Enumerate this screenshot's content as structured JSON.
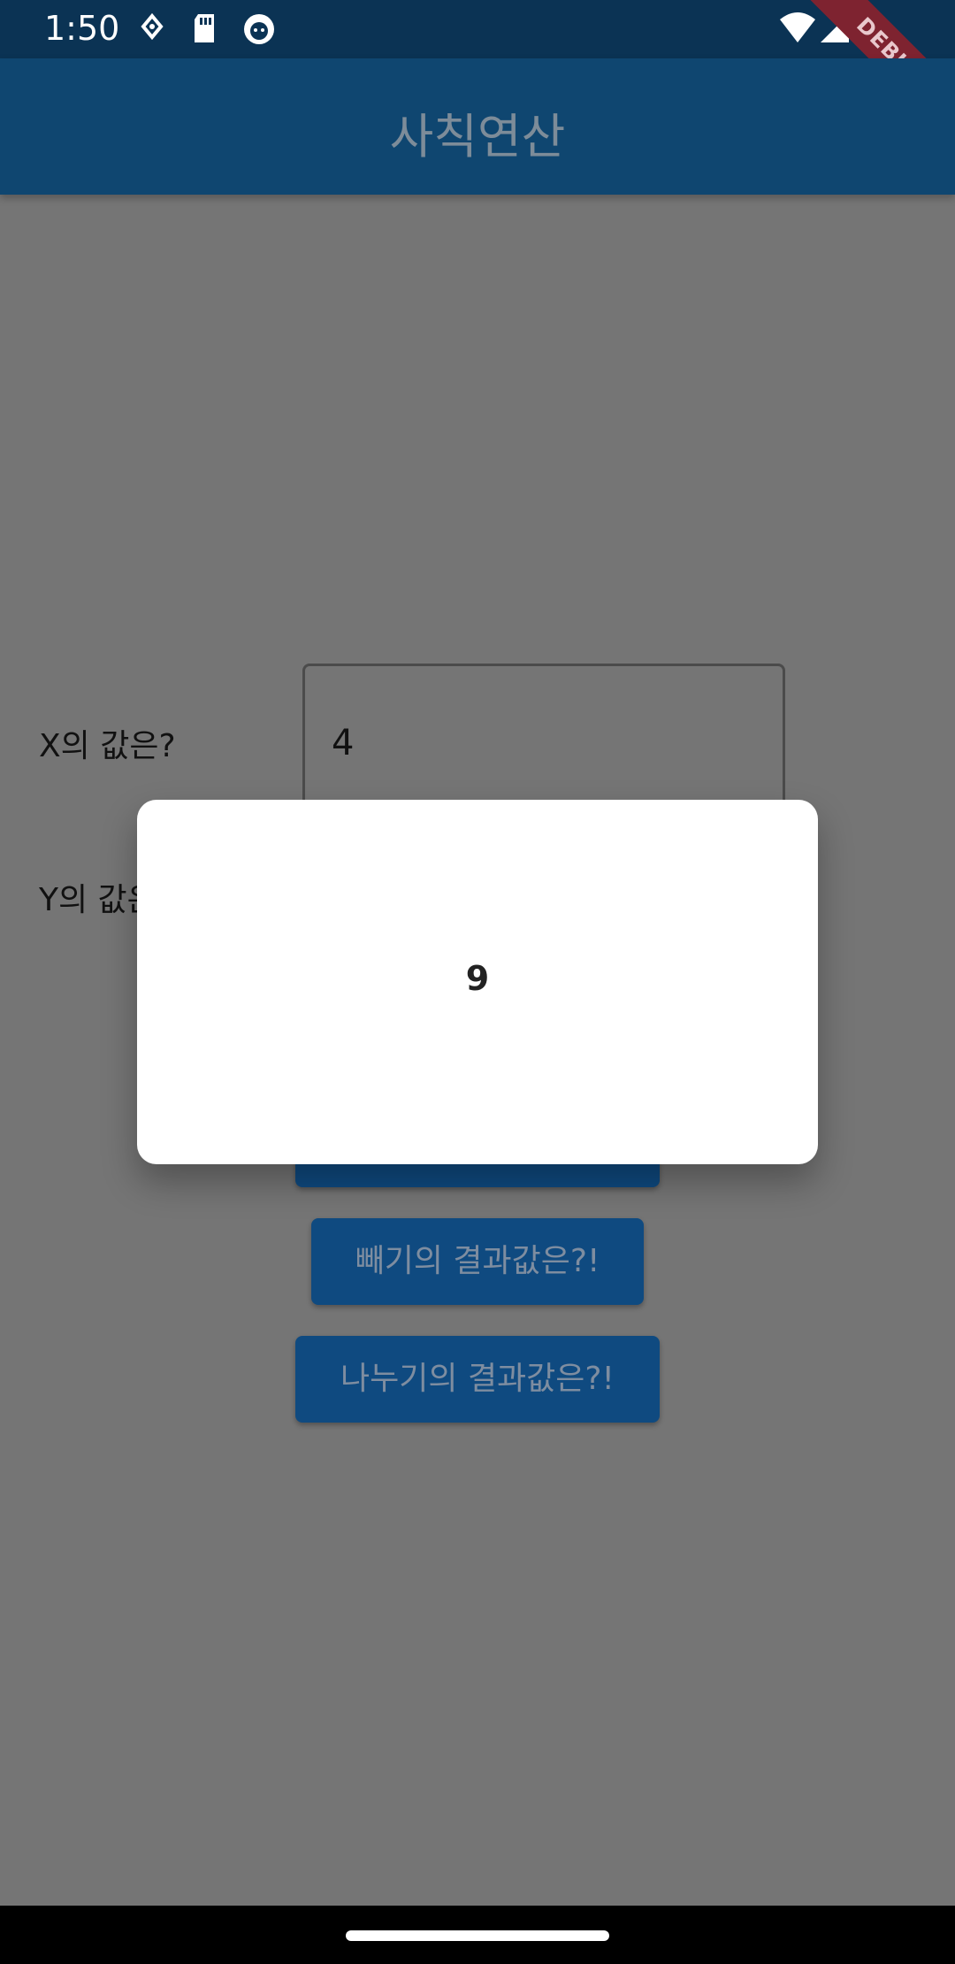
{
  "status_bar": {
    "time": "1:50",
    "icons": [
      "location-icon",
      "sd-card-icon",
      "cat-icon",
      "wifi-icon",
      "signal-icon"
    ]
  },
  "debug_banner": "DEBUG",
  "app_bar": {
    "title": "사칙연산"
  },
  "form": {
    "x_label": "X의 값은?",
    "x_value": "4",
    "y_label": "Y의 값은?"
  },
  "buttons": {
    "subtract": "빼기의 결과값은?!",
    "divide": "나누기의 결과값은?!"
  },
  "dialog": {
    "result": "9"
  },
  "colors": {
    "status_bar": "#0B3354",
    "app_bar": "#0F4670",
    "scrim": "#757575",
    "button": "#0F4A80",
    "dialog": "#FFFFFF"
  }
}
